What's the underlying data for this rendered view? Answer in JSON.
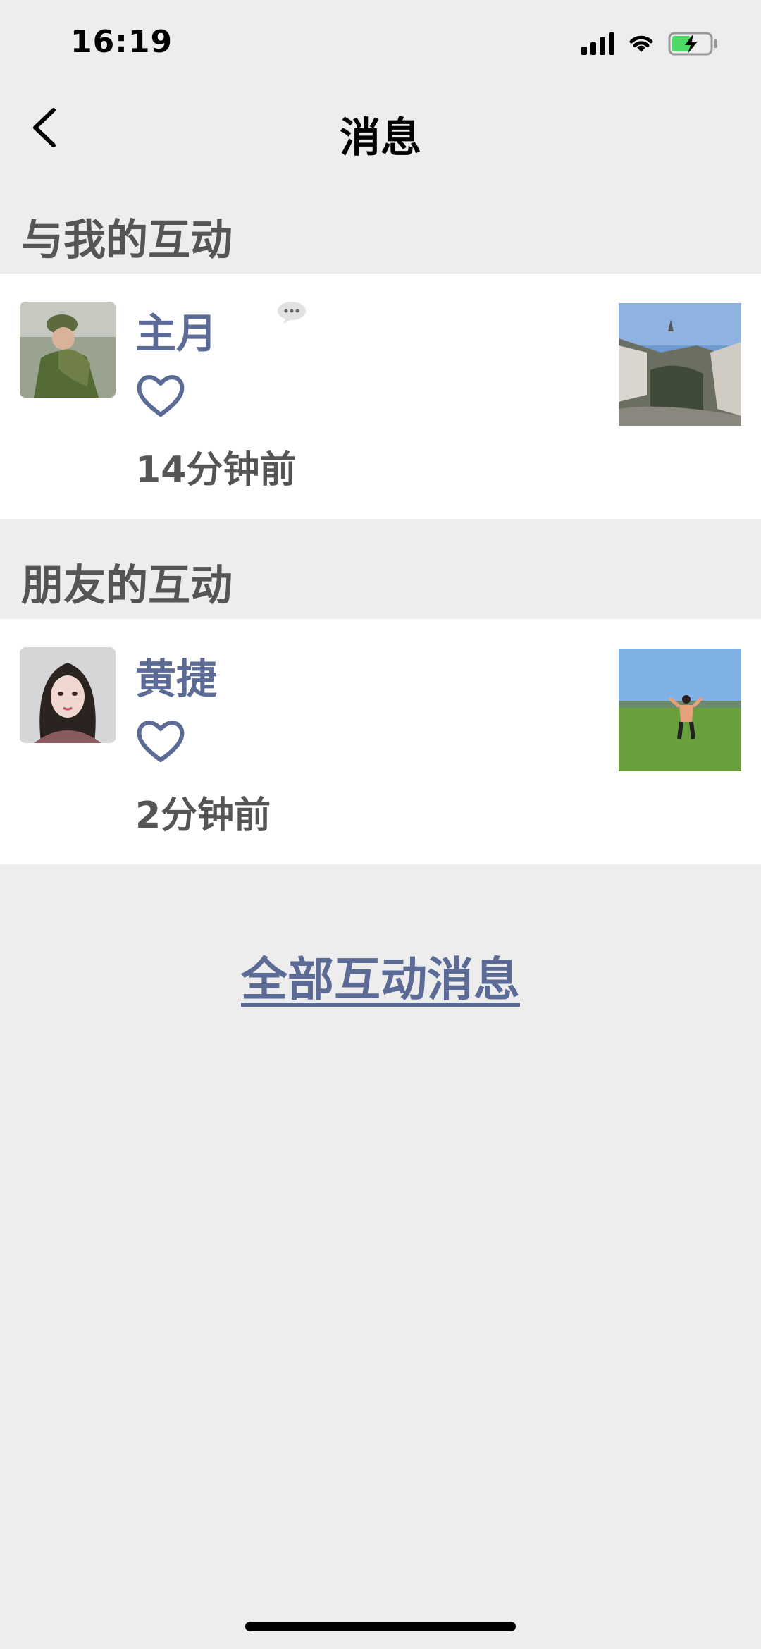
{
  "status_bar": {
    "time": "16:19"
  },
  "nav": {
    "title": "消息",
    "back_icon": "chevron-left-icon"
  },
  "sections": [
    {
      "title": "与我的互动",
      "items": [
        {
          "name": "主月",
          "reaction_icon": "heart-outline-icon",
          "time": "14分钟前",
          "has_comment_bubble": true
        }
      ]
    },
    {
      "title": "朋友的互动",
      "items": [
        {
          "name": "黄捷",
          "reaction_icon": "heart-outline-icon",
          "time": "2分钟前",
          "has_comment_bubble": false
        }
      ]
    }
  ],
  "footer": {
    "all_messages_label": "全部互动消息"
  },
  "colors": {
    "link": "#5b6b95",
    "background": "#ededed",
    "card": "#ffffff",
    "section_text": "#555555"
  }
}
